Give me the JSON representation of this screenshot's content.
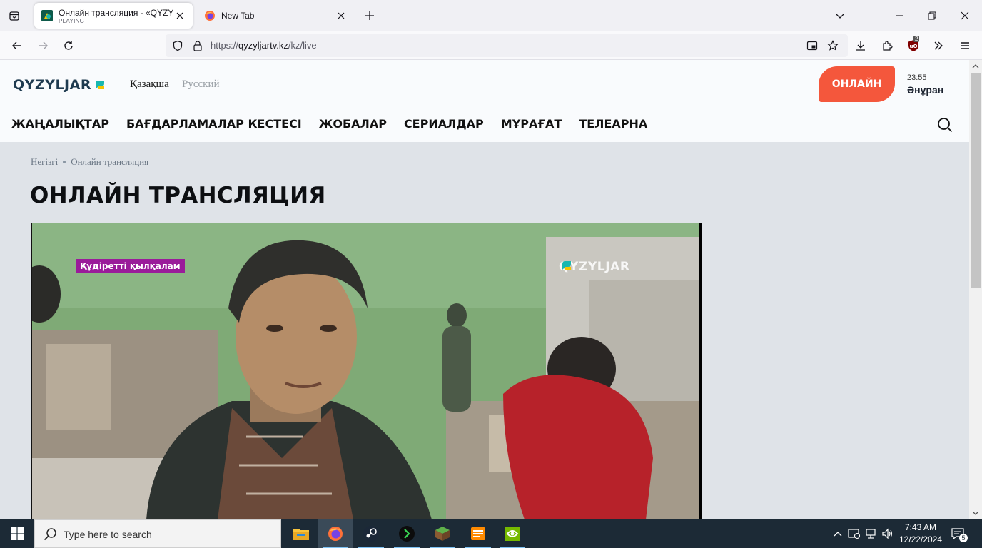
{
  "browser": {
    "tabs": [
      {
        "title": "Онлайн трансляция - «QYZYLJAR»",
        "status": "PLAYING",
        "active": true
      },
      {
        "title": "New Tab",
        "active": false
      }
    ],
    "url": {
      "prefix": "https://",
      "domain": "qyzyljartv.kz",
      "path": "/kz/live"
    },
    "extension_badge": "2"
  },
  "site": {
    "logo_text": "QYZYLJAR",
    "languages": {
      "kz": "Қазақша",
      "ru": "Русский"
    },
    "online_button": "ОНЛАЙН",
    "now_playing": {
      "time": "23:55",
      "title": "Әнұран"
    },
    "menu": [
      "ЖАҢАЛЫҚТАР",
      "БАҒДАРЛАМАЛАР КЕСТЕСІ",
      "ЖОБАЛАР",
      "СЕРИАЛДАР",
      "МҰРАҒАТ",
      "ТЕЛЕАРНА"
    ],
    "breadcrumb": {
      "home": "Негізгі",
      "current": "Онлайн трансляция"
    },
    "page_title": "ОНЛАЙН ТРАНСЛЯЦИЯ",
    "video": {
      "badge": "Құдіретті қылқалам",
      "watermark": "QYZYLJAR"
    },
    "colors": {
      "accent": "#f4573c",
      "logo_yellow": "#f5c400",
      "logo_teal": "#19b7b0",
      "badge": "#9a1b9a"
    }
  },
  "taskbar": {
    "search_placeholder": "Type here to search",
    "apps": [
      "file-explorer",
      "firefox",
      "steam",
      "terminal-app",
      "minecraft",
      "sublime-app",
      "nvidia-app"
    ],
    "clock": {
      "time": "7:43 AM",
      "date": "12/22/2024"
    },
    "notification_count": "5"
  }
}
